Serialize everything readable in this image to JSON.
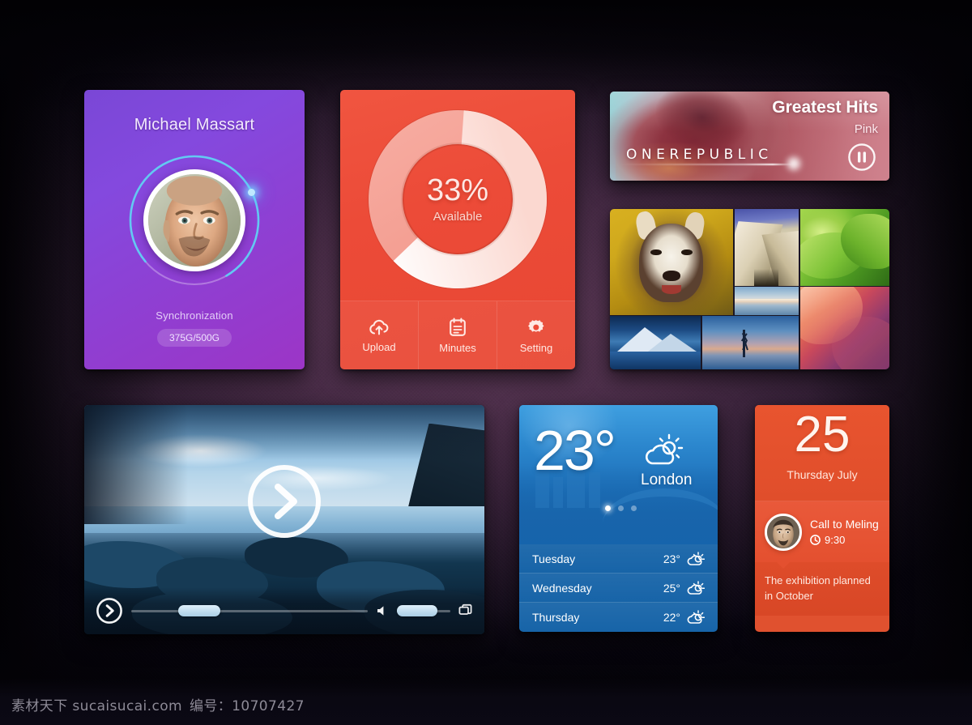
{
  "background": {
    "tone": "#2e1c31"
  },
  "profile": {
    "name": "Michael Massart",
    "sync_label": "Synchronization",
    "storage_badge": "375G/500G",
    "ring_progress_percent": 78,
    "accent": "#8449de"
  },
  "storage": {
    "percent_text": "33%",
    "percent_value": 33,
    "state_label": "Available",
    "accent": "#ec4b38",
    "actions": [
      {
        "label": "Upload",
        "icon": "cloud-upload-icon"
      },
      {
        "label": "Minutes",
        "icon": "notepad-icon"
      },
      {
        "label": "Setting",
        "icon": "gear-icon"
      }
    ]
  },
  "music": {
    "album_title": "Greatest Hits",
    "artist": "Pink",
    "band_wordmark": "ONEREPUBLIC",
    "transport_icon": "pause-icon",
    "progress_percent": 58
  },
  "photos": {
    "tiles": [
      {
        "name": "husky-dog-photo"
      },
      {
        "name": "architecture-photo"
      },
      {
        "name": "green-leaf-photo"
      },
      {
        "name": "seascape-photo"
      },
      {
        "name": "snow-mountain-photo"
      },
      {
        "name": "dusk-silhouette-photo"
      },
      {
        "name": "canyon-photo"
      }
    ]
  },
  "video": {
    "play_icon": "play-chevron-icon",
    "small_play_icon": "play-chevron-icon",
    "volume_icon": "speaker-icon",
    "fullscreen_icon": "screens-icon",
    "progress_percent": 24,
    "volume_percent": 76
  },
  "weather": {
    "temperature": "23°",
    "city": "London",
    "condition_icon": "sun-cloud-icon",
    "pager_dots": 3,
    "pager_active": 1,
    "forecast": [
      {
        "day": "Tuesday",
        "temp": "23°",
        "icon": "sun-cloud-icon"
      },
      {
        "day": "Wednesday",
        "temp": "25°",
        "icon": "sun-cloud-icon"
      },
      {
        "day": "Thursday",
        "temp": "22°",
        "icon": "sun-cloud-icon"
      }
    ]
  },
  "calendar": {
    "day_number": "25",
    "day_month": "Thursday  July",
    "event_title": "Call to Meling",
    "event_time": "9:30",
    "event_time_icon": "clock-icon",
    "note": "The exhibition planned in October",
    "accent": "#e0512f"
  },
  "watermark": {
    "site": "素材天下 sucaisucai.com",
    "id": "编号：10707427"
  }
}
